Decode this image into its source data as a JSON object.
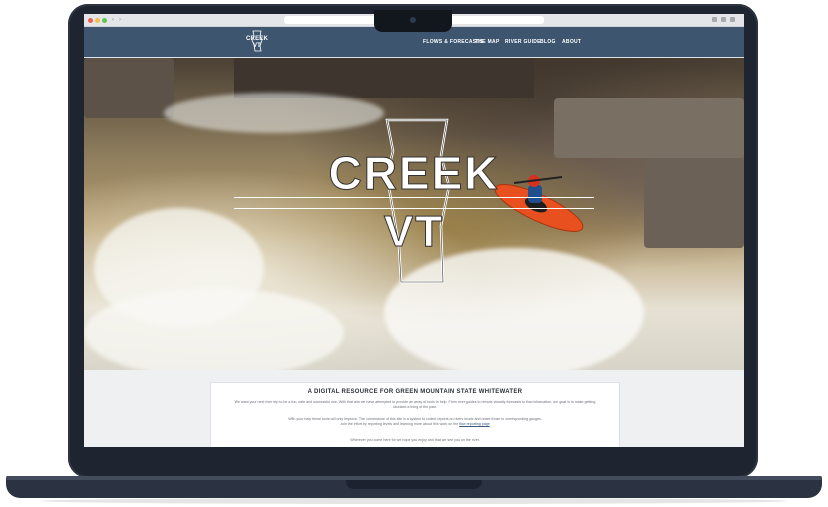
{
  "site": {
    "logo_line1": "CREEK",
    "logo_line2": "VT",
    "nav": [
      "FLOWS & FORECASTS",
      "THE MAP",
      "RIVER GUIDE",
      "BLOG",
      "ABOUT"
    ]
  },
  "hero": {
    "brand_line1": "CREEK",
    "brand_line2": "VT"
  },
  "content": {
    "title": "A DIGITAL RESOURCE FOR GREEN MOUNTAIN STATE WHITEWATER",
    "p1": "We want your next river trip to be a fun, safe and successful one.  With that aim we have attempted to provide an array of tools to help.  From river guides to remote visually forecasts to flow information, our goal is to make getting skunked a thing of the past.",
    "p2_a": "With your help these tools will only improve.  The cornerstone of this site is a system to collect reports on rivers levels and relate those to corresponding gauges.",
    "p2_b": "Join the effort by reporting levels and learning more about this work on the ",
    "p2_link": "flow reporting page",
    "p3": "Wherever you come here for we hope you enjoy and that we see you on the river."
  },
  "colors": {
    "header_bg": "#3e5570",
    "kayak": "#e8501f",
    "laptop": "#1f2530"
  }
}
